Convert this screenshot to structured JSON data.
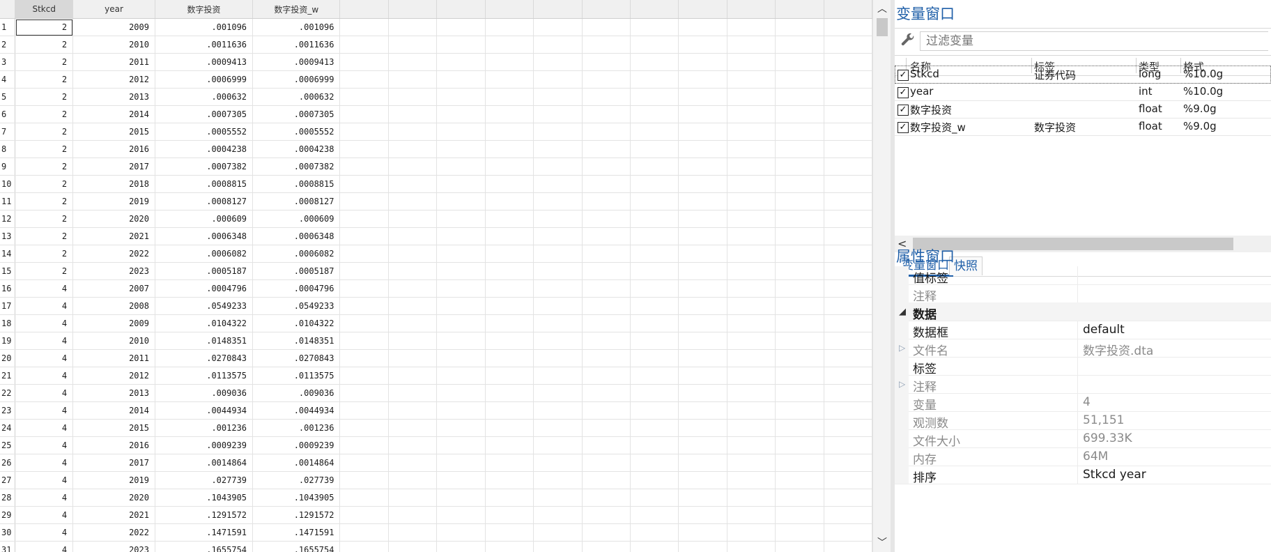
{
  "grid": {
    "columns": [
      "Stkcd",
      "year",
      "数字投资",
      "数字投资_w"
    ],
    "rows": [
      [
        "1",
        "2",
        "2009",
        ".001096",
        ".001096"
      ],
      [
        "2",
        "2",
        "2010",
        ".0011636",
        ".0011636"
      ],
      [
        "3",
        "2",
        "2011",
        ".0009413",
        ".0009413"
      ],
      [
        "4",
        "2",
        "2012",
        ".0006999",
        ".0006999"
      ],
      [
        "5",
        "2",
        "2013",
        ".000632",
        ".000632"
      ],
      [
        "6",
        "2",
        "2014",
        ".0007305",
        ".0007305"
      ],
      [
        "7",
        "2",
        "2015",
        ".0005552",
        ".0005552"
      ],
      [
        "8",
        "2",
        "2016",
        ".0004238",
        ".0004238"
      ],
      [
        "9",
        "2",
        "2017",
        ".0007382",
        ".0007382"
      ],
      [
        "10",
        "2",
        "2018",
        ".0008815",
        ".0008815"
      ],
      [
        "11",
        "2",
        "2019",
        ".0008127",
        ".0008127"
      ],
      [
        "12",
        "2",
        "2020",
        ".000609",
        ".000609"
      ],
      [
        "13",
        "2",
        "2021",
        ".0006348",
        ".0006348"
      ],
      [
        "14",
        "2",
        "2022",
        ".0006082",
        ".0006082"
      ],
      [
        "15",
        "2",
        "2023",
        ".0005187",
        ".0005187"
      ],
      [
        "16",
        "4",
        "2007",
        ".0004796",
        ".0004796"
      ],
      [
        "17",
        "4",
        "2008",
        ".0549233",
        ".0549233"
      ],
      [
        "18",
        "4",
        "2009",
        ".0104322",
        ".0104322"
      ],
      [
        "19",
        "4",
        "2010",
        ".0148351",
        ".0148351"
      ],
      [
        "20",
        "4",
        "2011",
        ".0270843",
        ".0270843"
      ],
      [
        "21",
        "4",
        "2012",
        ".0113575",
        ".0113575"
      ],
      [
        "22",
        "4",
        "2013",
        ".009036",
        ".009036"
      ],
      [
        "23",
        "4",
        "2014",
        ".0044934",
        ".0044934"
      ],
      [
        "24",
        "4",
        "2015",
        ".001236",
        ".001236"
      ],
      [
        "25",
        "4",
        "2016",
        ".0009239",
        ".0009239"
      ],
      [
        "26",
        "4",
        "2017",
        ".0014864",
        ".0014864"
      ],
      [
        "27",
        "4",
        "2019",
        ".027739",
        ".027739"
      ],
      [
        "28",
        "4",
        "2020",
        ".1043905",
        ".1043905"
      ],
      [
        "29",
        "4",
        "2021",
        ".1291572",
        ".1291572"
      ],
      [
        "30",
        "4",
        "2022",
        ".1471591",
        ".1471591"
      ],
      [
        "31",
        "4",
        "2023",
        ".1655754",
        ".1655754"
      ]
    ],
    "scroll_up": "︿",
    "scroll_down": "﹀"
  },
  "variables_window": {
    "title": "变量窗口",
    "filter_placeholder": "过滤变量",
    "headers": {
      "name": "名称",
      "label": "标签",
      "type": "类型",
      "format": "格式"
    },
    "variables": [
      {
        "name": "Stkcd",
        "label": "证券代码",
        "type": "long",
        "format": "%10.0g",
        "checked": "✓"
      },
      {
        "name": "year",
        "label": "",
        "type": "int",
        "format": "%10.0g",
        "checked": "✓"
      },
      {
        "name": "数字投资",
        "label": "",
        "type": "float",
        "format": "%9.0g",
        "checked": "✓"
      },
      {
        "name": "数字投资_w",
        "label": "数字投资",
        "type": "float",
        "format": "%9.0g",
        "checked": "✓"
      }
    ],
    "scroll_left": "<"
  },
  "tabs": {
    "variables": "变量窗口",
    "snapshots": "快照"
  },
  "properties_window": {
    "title": "属性窗口",
    "rows": [
      {
        "key": "值标签",
        "value": "",
        "style": "dark",
        "expander": ""
      },
      {
        "key": "注释",
        "value": "",
        "style": "muted",
        "expander": ""
      },
      {
        "key": "数据",
        "value": "",
        "style": "section",
        "expander": "◢"
      },
      {
        "key": "数据框",
        "value": "default",
        "style": "dark",
        "expander": ""
      },
      {
        "key": "文件名",
        "value": "数字投资.dta",
        "style": "muted",
        "expander": "▷"
      },
      {
        "key": "标签",
        "value": "",
        "style": "dark",
        "expander": ""
      },
      {
        "key": "注释",
        "value": "",
        "style": "muted",
        "expander": "▷"
      },
      {
        "key": "变量",
        "value": "4",
        "style": "muted",
        "expander": ""
      },
      {
        "key": "观测数",
        "value": "51,151",
        "style": "muted",
        "expander": ""
      },
      {
        "key": "文件大小",
        "value": "699.33K",
        "style": "muted",
        "expander": ""
      },
      {
        "key": "内存",
        "value": "64M",
        "style": "muted",
        "expander": ""
      },
      {
        "key": "排序",
        "value": "Stkcd year",
        "style": "dark",
        "expander": ""
      }
    ]
  },
  "icons": {
    "filter": "wrench-icon"
  }
}
